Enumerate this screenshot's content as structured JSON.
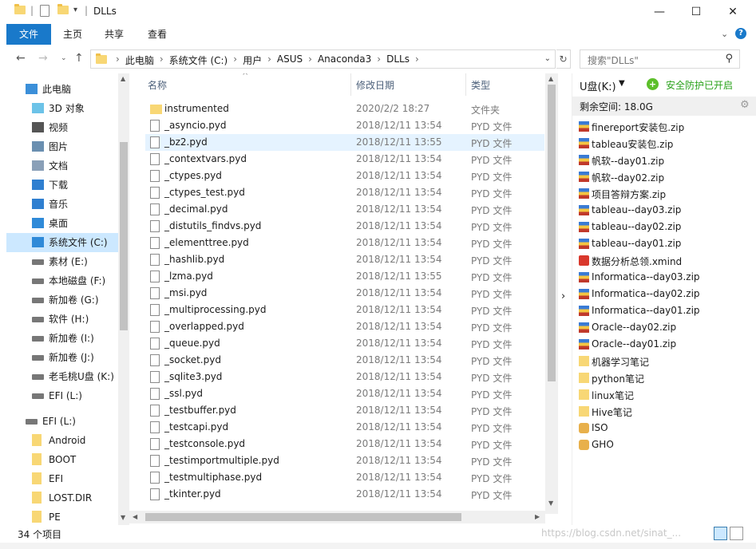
{
  "window": {
    "title": "DLLs"
  },
  "ribbon": {
    "tabs": [
      "文件",
      "主页",
      "共享",
      "查看"
    ]
  },
  "address": {
    "crumbs": [
      "此电脑",
      "系统文件 (C:)",
      "用户",
      "ASUS",
      "Anaconda3",
      "DLLs"
    ],
    "search_placeholder": "搜索\"DLLs\""
  },
  "nav": {
    "items": [
      {
        "label": "此电脑",
        "icon": "computer-icon"
      },
      {
        "label": "3D 对象",
        "icon": "cube-icon"
      },
      {
        "label": "视频",
        "icon": "video-icon"
      },
      {
        "label": "图片",
        "icon": "picture-icon"
      },
      {
        "label": "文档",
        "icon": "document-icon"
      },
      {
        "label": "下载",
        "icon": "download-icon"
      },
      {
        "label": "音乐",
        "icon": "music-icon"
      },
      {
        "label": "桌面",
        "icon": "desktop-icon"
      },
      {
        "label": "系统文件 (C:)",
        "icon": "windows-drive-icon"
      },
      {
        "label": "素材 (E:)",
        "icon": "drive-icon"
      },
      {
        "label": "本地磁盘 (F:)",
        "icon": "drive-icon"
      },
      {
        "label": "新加卷 (G:)",
        "icon": "drive-icon"
      },
      {
        "label": "软件 (H:)",
        "icon": "drive-icon"
      },
      {
        "label": "新加卷 (I:)",
        "icon": "drive-icon"
      },
      {
        "label": "新加卷 (J:)",
        "icon": "drive-icon"
      },
      {
        "label": "老毛桃U盘 (K:)",
        "icon": "drive-icon"
      },
      {
        "label": "EFI (L:)",
        "icon": "drive-icon"
      },
      {
        "label": "EFI (L:)",
        "icon": "drive-icon"
      },
      {
        "label": "Android",
        "icon": "folder-icon"
      },
      {
        "label": "BOOT",
        "icon": "folder-icon"
      },
      {
        "label": "EFI",
        "icon": "folder-icon"
      },
      {
        "label": "LOST.DIR",
        "icon": "folder-icon"
      },
      {
        "label": "PE",
        "icon": "folder-icon"
      }
    ]
  },
  "list": {
    "columns": {
      "name": "名称",
      "date": "修改日期",
      "type": "类型"
    },
    "rows": [
      {
        "name": "instrumented",
        "date": "2020/2/2 18:27",
        "type": "文件夹",
        "kind": "folder"
      },
      {
        "name": "_asyncio.pyd",
        "date": "2018/12/11 13:54",
        "type": "PYD 文件",
        "kind": "file"
      },
      {
        "name": "_bz2.pyd",
        "date": "2018/12/11 13:55",
        "type": "PYD 文件",
        "kind": "file"
      },
      {
        "name": "_contextvars.pyd",
        "date": "2018/12/11 13:54",
        "type": "PYD 文件",
        "kind": "file"
      },
      {
        "name": "_ctypes.pyd",
        "date": "2018/12/11 13:54",
        "type": "PYD 文件",
        "kind": "file"
      },
      {
        "name": "_ctypes_test.pyd",
        "date": "2018/12/11 13:54",
        "type": "PYD 文件",
        "kind": "file"
      },
      {
        "name": "_decimal.pyd",
        "date": "2018/12/11 13:54",
        "type": "PYD 文件",
        "kind": "file"
      },
      {
        "name": "_distutils_findvs.pyd",
        "date": "2018/12/11 13:54",
        "type": "PYD 文件",
        "kind": "file"
      },
      {
        "name": "_elementtree.pyd",
        "date": "2018/12/11 13:54",
        "type": "PYD 文件",
        "kind": "file"
      },
      {
        "name": "_hashlib.pyd",
        "date": "2018/12/11 13:54",
        "type": "PYD 文件",
        "kind": "file"
      },
      {
        "name": "_lzma.pyd",
        "date": "2018/12/11 13:55",
        "type": "PYD 文件",
        "kind": "file"
      },
      {
        "name": "_msi.pyd",
        "date": "2018/12/11 13:54",
        "type": "PYD 文件",
        "kind": "file"
      },
      {
        "name": "_multiprocessing.pyd",
        "date": "2018/12/11 13:54",
        "type": "PYD 文件",
        "kind": "file"
      },
      {
        "name": "_overlapped.pyd",
        "date": "2018/12/11 13:54",
        "type": "PYD 文件",
        "kind": "file"
      },
      {
        "name": "_queue.pyd",
        "date": "2018/12/11 13:54",
        "type": "PYD 文件",
        "kind": "file"
      },
      {
        "name": "_socket.pyd",
        "date": "2018/12/11 13:54",
        "type": "PYD 文件",
        "kind": "file"
      },
      {
        "name": "_sqlite3.pyd",
        "date": "2018/12/11 13:54",
        "type": "PYD 文件",
        "kind": "file"
      },
      {
        "name": "_ssl.pyd",
        "date": "2018/12/11 13:54",
        "type": "PYD 文件",
        "kind": "file"
      },
      {
        "name": "_testbuffer.pyd",
        "date": "2018/12/11 13:54",
        "type": "PYD 文件",
        "kind": "file"
      },
      {
        "name": "_testcapi.pyd",
        "date": "2018/12/11 13:54",
        "type": "PYD 文件",
        "kind": "file"
      },
      {
        "name": "_testconsole.pyd",
        "date": "2018/12/11 13:54",
        "type": "PYD 文件",
        "kind": "file"
      },
      {
        "name": "_testimportmultiple.pyd",
        "date": "2018/12/11 13:54",
        "type": "PYD 文件",
        "kind": "file"
      },
      {
        "name": "_testmultiphase.pyd",
        "date": "2018/12/11 13:54",
        "type": "PYD 文件",
        "kind": "file"
      },
      {
        "name": "_tkinter.pyd",
        "date": "2018/12/11 13:54",
        "type": "PYD 文件",
        "kind": "file"
      }
    ],
    "selected_index": 2
  },
  "pane": {
    "drive": "U盘(K:)",
    "safe": "安全防护已开启",
    "space": "剩余空间: 18.0G",
    "items": [
      {
        "name": "finereport安装包.zip",
        "kind": "zip"
      },
      {
        "name": "tableau安装包.zip",
        "kind": "zip"
      },
      {
        "name": "帆软--day01.zip",
        "kind": "zip"
      },
      {
        "name": "帆软--day02.zip",
        "kind": "zip"
      },
      {
        "name": "项目答辩方案.zip",
        "kind": "zip"
      },
      {
        "name": "tableau--day03.zip",
        "kind": "zip"
      },
      {
        "name": "tableau--day02.zip",
        "kind": "zip"
      },
      {
        "name": "tableau--day01.zip",
        "kind": "zip"
      },
      {
        "name": "数据分析总领.xmind",
        "kind": "xmind"
      },
      {
        "name": "Informatica--day03.zip",
        "kind": "zip"
      },
      {
        "name": "Informatica--day02.zip",
        "kind": "zip"
      },
      {
        "name": "Informatica--day01.zip",
        "kind": "zip"
      },
      {
        "name": "Oracle--day02.zip",
        "kind": "zip"
      },
      {
        "name": "Oracle--day01.zip",
        "kind": "zip"
      },
      {
        "name": "机器学习笔记",
        "kind": "folder"
      },
      {
        "name": "python笔记",
        "kind": "folder"
      },
      {
        "name": "linux笔记",
        "kind": "folder"
      },
      {
        "name": "Hive笔记",
        "kind": "folder"
      },
      {
        "name": "ISO",
        "kind": "iso"
      },
      {
        "name": "GHO",
        "kind": "iso"
      }
    ]
  },
  "status": {
    "count": "34 个项目",
    "watermark": "https://blog.csdn.net/sinat_..."
  }
}
